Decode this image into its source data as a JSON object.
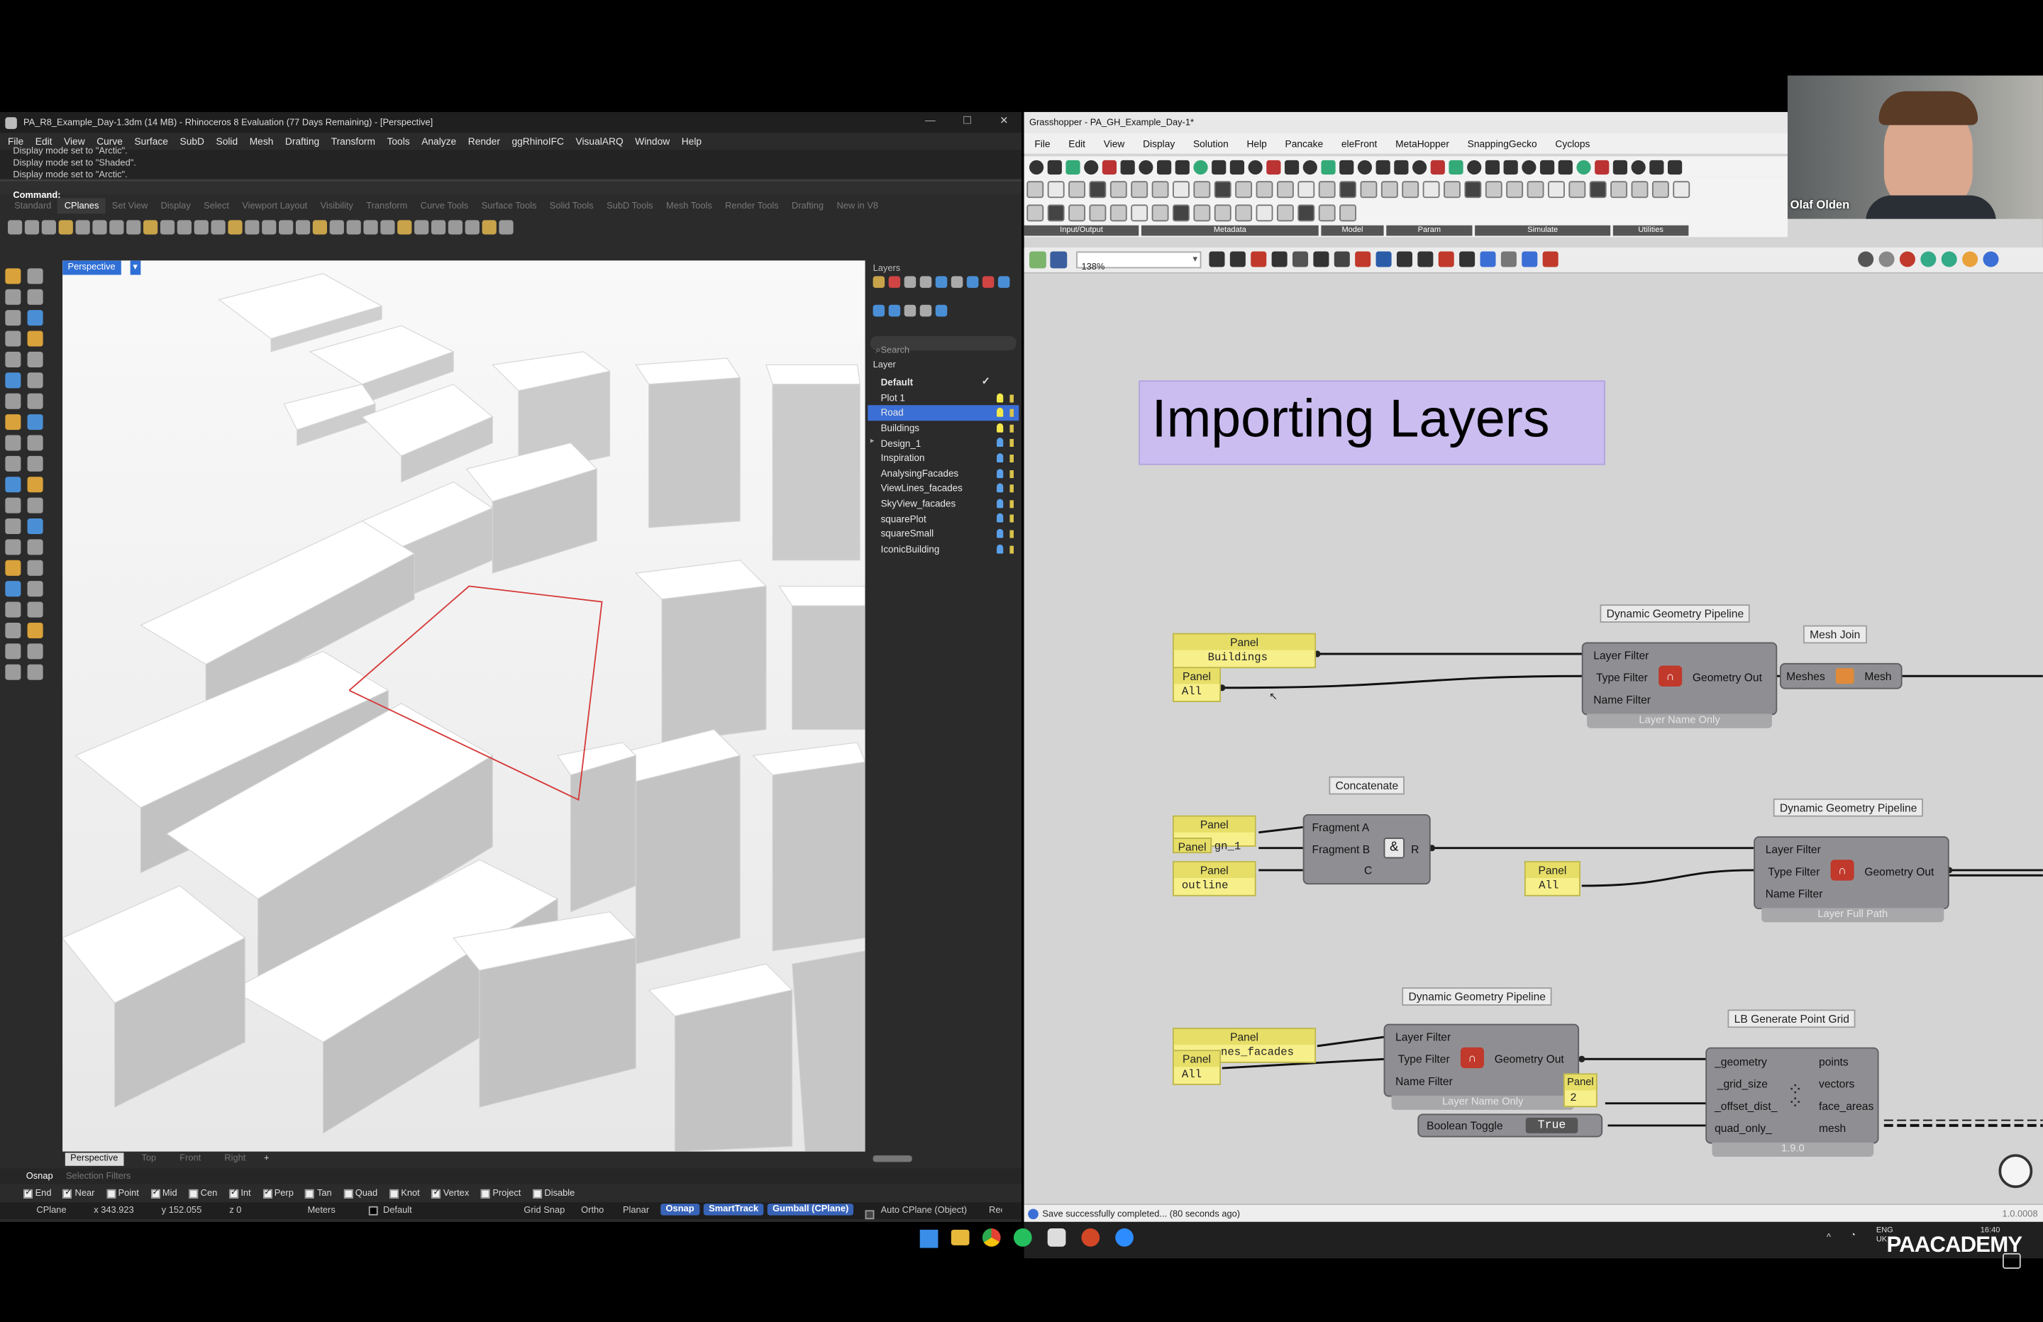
{
  "rhino": {
    "title": "PA_R8_Example_Day-1.3dm (14 MB) - Rhinoceros 8 Evaluation (77 Days Remaining) - [Perspective]",
    "menu": [
      "File",
      "Edit",
      "View",
      "Curve",
      "Surface",
      "SubD",
      "Solid",
      "Mesh",
      "Drafting",
      "Transform",
      "Tools",
      "Analyze",
      "Render",
      "ggRhinoIFC",
      "VisualARQ",
      "Window",
      "Help"
    ],
    "history": [
      "Display mode set to \"Arctic\".",
      "Display mode set to \"Shaded\".",
      "Display mode set to \"Arctic\"."
    ],
    "command_label": "Command:",
    "tabs": [
      "Standard",
      "CPlanes",
      "Set View",
      "Display",
      "Select",
      "Viewport Layout",
      "Visibility",
      "Transform",
      "Curve Tools",
      "Surface Tools",
      "Solid Tools",
      "SubD Tools",
      "Mesh Tools",
      "Render Tools",
      "Drafting",
      "New in V8"
    ],
    "viewport_label": "Perspective",
    "view_tabs": [
      "Perspective",
      "Top",
      "Front",
      "Right"
    ],
    "layers_panel_title": "Layers",
    "search_placeholder": "Search",
    "layer_header": "Layer",
    "layers": [
      {
        "name": "Default",
        "bulb": "#d8d8d8"
      },
      {
        "name": "Plot 1",
        "bulb": "#f2e84a"
      },
      {
        "name": "Road",
        "bulb": "#f2e84a"
      },
      {
        "name": "Buildings",
        "bulb": "#f2e84a"
      },
      {
        "name": "Design_1",
        "bulb": "#5aa0e8"
      },
      {
        "name": "Inspiration",
        "bulb": "#5aa0e8"
      },
      {
        "name": "AnalysingFacades",
        "bulb": "#5aa0e8"
      },
      {
        "name": "ViewLines_facades",
        "bulb": "#5aa0e8"
      },
      {
        "name": "SkyView_facades",
        "bulb": "#5aa0e8"
      },
      {
        "name": "squarePlot",
        "bulb": "#5aa0e8"
      },
      {
        "name": "squareSmall",
        "bulb": "#5aa0e8"
      },
      {
        "name": "IconicBuilding",
        "bulb": "#5aa0e8"
      }
    ],
    "osnap_tabs": [
      "Osnap",
      "Selection Filters"
    ],
    "osnaps": [
      {
        "label": "End",
        "on": true
      },
      {
        "label": "Near",
        "on": true
      },
      {
        "label": "Point",
        "on": false
      },
      {
        "label": "Mid",
        "on": true
      },
      {
        "label": "Cen",
        "on": false
      },
      {
        "label": "Int",
        "on": true
      },
      {
        "label": "Perp",
        "on": true
      },
      {
        "label": "Tan",
        "on": false
      },
      {
        "label": "Quad",
        "on": false
      },
      {
        "label": "Knot",
        "on": false
      },
      {
        "label": "Vertex",
        "on": true
      },
      {
        "label": "Project",
        "on": false
      },
      {
        "label": "Disable",
        "on": false
      }
    ],
    "status": {
      "cplane": "CPlane",
      "x": "x 343.923",
      "y": "y 152.055",
      "z": "z 0",
      "units": "Meters",
      "layer": "Default",
      "toggles": [
        "Grid Snap",
        "Ortho",
        "Planar",
        "Osnap",
        "SmartTrack",
        "Gumball (CPlane)"
      ],
      "auto_cplane": "Auto CPlane (Object)",
      "rec": "Rec"
    }
  },
  "gh": {
    "title": "Grasshopper - PA_GH_Example_Day-1*",
    "menu": [
      "File",
      "Edit",
      "View",
      "Display",
      "Solution",
      "Help",
      "Pancake",
      "eleFront",
      "MetaHopper",
      "SnappingGecko",
      "Cyclops"
    ],
    "ribbon_groups": [
      "Input/Output",
      "Metadata",
      "Model",
      "Param",
      "Simulate",
      "Utilities"
    ],
    "zoom": "138%",
    "heading": "Importing Layers",
    "comp1": {
      "label": "Dynamic Geometry Pipeline",
      "inputs": [
        "Layer Filter",
        "Type Filter",
        "Name Filter"
      ],
      "output": "Geometry Out",
      "mode": "Layer Name Only"
    },
    "meshjoin": {
      "label": "Mesh Join",
      "in": "Meshes",
      "out": "Mesh"
    },
    "panelA": {
      "head": "Panel",
      "value": "Buildings"
    },
    "panelB": {
      "head": "Panel",
      "value": "All"
    },
    "concat": {
      "label": "Concatenate",
      "inputs": [
        "Fragment A",
        "Fragment B",
        "C"
      ],
      "output": "R"
    },
    "panelC": {
      "head": "Panel",
      "value": ""
    },
    "panelD": {
      "head": "Panel",
      "value": "gn_1"
    },
    "panelE": {
      "head": "Panel",
      "value": "outline"
    },
    "panelF": {
      "head": "Panel",
      "value": "All"
    },
    "comp2": {
      "label": "Dynamic Geometry Pipeline",
      "inputs": [
        "Layer Filter",
        "Type Filter",
        "Name Filter"
      ],
      "output": "Geometry Out",
      "mode": "Layer Full Path"
    },
    "comp3": {
      "label": "Dynamic Geometry Pipeline",
      "inputs": [
        "Layer Filter",
        "Type Filter",
        "Name Filter"
      ],
      "output": "Geometry Out",
      "mode": "Layer Name Only"
    },
    "panelG": {
      "head": "Panel",
      "value": "nes_facades"
    },
    "panelH": {
      "head": "Panel",
      "value": "All"
    },
    "panelI": {
      "head": "Panel",
      "value": "2"
    },
    "toggle": {
      "label": "Boolean Toggle",
      "value": "True"
    },
    "lbgrid": {
      "label": "LB Generate Point Grid",
      "inputs": [
        "_geometry",
        "_grid_size",
        "_offset_dist_",
        "quad_only_"
      ],
      "outputs": [
        "points",
        "vectors",
        "face_areas",
        "mesh"
      ],
      "version": "1.9.0"
    },
    "status": "Save successfully completed... (80 seconds ago)",
    "version": "1.0.0008"
  },
  "webcam": {
    "name": "Olaf Olden"
  },
  "taskbar": {
    "lang": "ENG",
    "lang2": "UK",
    "time": "16:40",
    "brand": "PAACADEMY"
  }
}
